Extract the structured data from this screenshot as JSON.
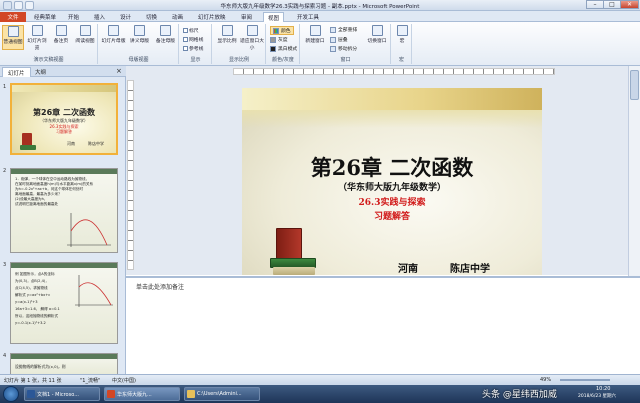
{
  "window": {
    "title": "华东师大版九年级数学26.3实践与探索习题 - 副本.pptx - Microsoft PowerPoint",
    "minimize": "–",
    "maximize": "□",
    "close": "✕"
  },
  "tabs": [
    "文件",
    "经典菜单",
    "开始",
    "插入",
    "设计",
    "切换",
    "动画",
    "幻灯片放映",
    "审阅",
    "视图",
    "开发工具"
  ],
  "ribbon": {
    "groups": {
      "views": {
        "label": "演示文稿视图",
        "items": [
          "普通视图",
          "幻灯片浏览",
          "备注页",
          "阅读视图"
        ]
      },
      "master": {
        "label": "母版视图",
        "items": [
          "幻灯片母版",
          "讲义母版",
          "备注母版"
        ]
      },
      "show": {
        "label": "显示",
        "items": [
          "标尺",
          "网格线",
          "参考线"
        ]
      },
      "zoom": {
        "label": "显示比例",
        "items": [
          "显示比例",
          "适应窗口大小"
        ]
      },
      "color": {
        "label": "颜色/灰度",
        "items": [
          "颜色",
          "灰度",
          "黑白模式"
        ]
      },
      "window": {
        "label": "窗口",
        "items": [
          "新建窗口",
          "全部重排",
          "层叠",
          "移动拆分",
          "切换窗口"
        ]
      },
      "macro": {
        "label": "宏",
        "items": [
          "宏"
        ]
      }
    }
  },
  "panel": {
    "tab1": "幻灯片",
    "tab2": "大纲",
    "close": "×"
  },
  "slides": [
    {
      "num": "1",
      "title": "第26章 二次函数",
      "sub": "（华东师大版九年级数学）",
      "sub2": "26.3实践与探索",
      "sub3": "习题解答",
      "school1": "河南",
      "school2": "陈店中学"
    },
    {
      "num": "2",
      "lines": [
        "1．炮弹，一个球体在空中运动路线为抛物线，",
        "在某时刻离地面高度h(m)与水平距离x(m)的关系",
        "为h=-0.2x²+ax+b，问这个球体在何处时",
        "离地面最高，最高为多少米？",
        "(2)设最大高度为h，",
        "试说明它距离地面的最高处"
      ]
    },
    {
      "num": "3",
      "lines": [
        "例 如图所示，点A的坐标",
        "为(0,3)，点B(2,4)，",
        "点C(4,5)，求抛物线",
        "解析式 y=ax²+bx+c",
        "y=a(x-1)²+3",
        "16a+3=1.6，  解得  a=0.1",
        "所以，这段抛物线的解析式",
        "y=-0.1(x-1)²+3.2"
      ]
    },
    {
      "num": "4",
      "lines": [
        "设抛物线的解析式为(x,0)，则"
      ]
    }
  ],
  "main_slide": {
    "title": "第26章  二次函数",
    "subtitle": "（华东师大版九年级数学）",
    "section": "26.3实践与探索",
    "section2": "习题解答",
    "school_left": "河南",
    "school_right": "陈店中学"
  },
  "notes_placeholder": "单击此处添加备注",
  "status": {
    "slide": "幻灯片 第 1 张，共 11 张",
    "theme": "\"1_流畅\"",
    "lang": "中文(中国)",
    "zoom": "49%"
  },
  "taskbar": [
    {
      "label": "文档1 - Microso..."
    },
    {
      "label": "华东师大版九..."
    },
    {
      "label": "C:\\Users\\Admini..."
    }
  ],
  "clock": {
    "time": "10:20",
    "date": "2018/6/23 星期六"
  },
  "watermark": "头条 @星纬西加威",
  "colors": {
    "accent": "#d24726",
    "slide_title": "#111111",
    "slide_red": "#d11a1a",
    "selected": "#f2b13a"
  }
}
